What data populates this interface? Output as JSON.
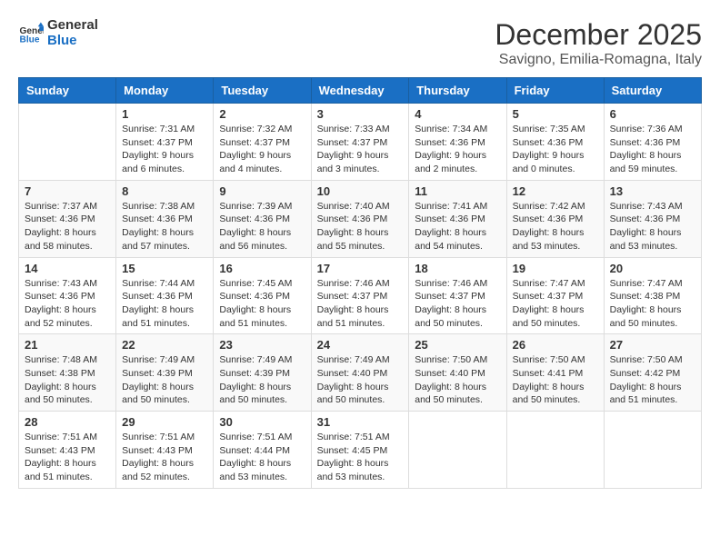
{
  "logo": {
    "text_general": "General",
    "text_blue": "Blue"
  },
  "header": {
    "month": "December 2025",
    "location": "Savigno, Emilia-Romagna, Italy"
  },
  "weekdays": [
    "Sunday",
    "Monday",
    "Tuesday",
    "Wednesday",
    "Thursday",
    "Friday",
    "Saturday"
  ],
  "weeks": [
    [
      {
        "day": "",
        "sunrise": "",
        "sunset": "",
        "daylight": ""
      },
      {
        "day": "1",
        "sunrise": "Sunrise: 7:31 AM",
        "sunset": "Sunset: 4:37 PM",
        "daylight": "Daylight: 9 hours and 6 minutes."
      },
      {
        "day": "2",
        "sunrise": "Sunrise: 7:32 AM",
        "sunset": "Sunset: 4:37 PM",
        "daylight": "Daylight: 9 hours and 4 minutes."
      },
      {
        "day": "3",
        "sunrise": "Sunrise: 7:33 AM",
        "sunset": "Sunset: 4:37 PM",
        "daylight": "Daylight: 9 hours and 3 minutes."
      },
      {
        "day": "4",
        "sunrise": "Sunrise: 7:34 AM",
        "sunset": "Sunset: 4:36 PM",
        "daylight": "Daylight: 9 hours and 2 minutes."
      },
      {
        "day": "5",
        "sunrise": "Sunrise: 7:35 AM",
        "sunset": "Sunset: 4:36 PM",
        "daylight": "Daylight: 9 hours and 0 minutes."
      },
      {
        "day": "6",
        "sunrise": "Sunrise: 7:36 AM",
        "sunset": "Sunset: 4:36 PM",
        "daylight": "Daylight: 8 hours and 59 minutes."
      }
    ],
    [
      {
        "day": "7",
        "sunrise": "Sunrise: 7:37 AM",
        "sunset": "Sunset: 4:36 PM",
        "daylight": "Daylight: 8 hours and 58 minutes."
      },
      {
        "day": "8",
        "sunrise": "Sunrise: 7:38 AM",
        "sunset": "Sunset: 4:36 PM",
        "daylight": "Daylight: 8 hours and 57 minutes."
      },
      {
        "day": "9",
        "sunrise": "Sunrise: 7:39 AM",
        "sunset": "Sunset: 4:36 PM",
        "daylight": "Daylight: 8 hours and 56 minutes."
      },
      {
        "day": "10",
        "sunrise": "Sunrise: 7:40 AM",
        "sunset": "Sunset: 4:36 PM",
        "daylight": "Daylight: 8 hours and 55 minutes."
      },
      {
        "day": "11",
        "sunrise": "Sunrise: 7:41 AM",
        "sunset": "Sunset: 4:36 PM",
        "daylight": "Daylight: 8 hours and 54 minutes."
      },
      {
        "day": "12",
        "sunrise": "Sunrise: 7:42 AM",
        "sunset": "Sunset: 4:36 PM",
        "daylight": "Daylight: 8 hours and 53 minutes."
      },
      {
        "day": "13",
        "sunrise": "Sunrise: 7:43 AM",
        "sunset": "Sunset: 4:36 PM",
        "daylight": "Daylight: 8 hours and 53 minutes."
      }
    ],
    [
      {
        "day": "14",
        "sunrise": "Sunrise: 7:43 AM",
        "sunset": "Sunset: 4:36 PM",
        "daylight": "Daylight: 8 hours and 52 minutes."
      },
      {
        "day": "15",
        "sunrise": "Sunrise: 7:44 AM",
        "sunset": "Sunset: 4:36 PM",
        "daylight": "Daylight: 8 hours and 51 minutes."
      },
      {
        "day": "16",
        "sunrise": "Sunrise: 7:45 AM",
        "sunset": "Sunset: 4:36 PM",
        "daylight": "Daylight: 8 hours and 51 minutes."
      },
      {
        "day": "17",
        "sunrise": "Sunrise: 7:46 AM",
        "sunset": "Sunset: 4:37 PM",
        "daylight": "Daylight: 8 hours and 51 minutes."
      },
      {
        "day": "18",
        "sunrise": "Sunrise: 7:46 AM",
        "sunset": "Sunset: 4:37 PM",
        "daylight": "Daylight: 8 hours and 50 minutes."
      },
      {
        "day": "19",
        "sunrise": "Sunrise: 7:47 AM",
        "sunset": "Sunset: 4:37 PM",
        "daylight": "Daylight: 8 hours and 50 minutes."
      },
      {
        "day": "20",
        "sunrise": "Sunrise: 7:47 AM",
        "sunset": "Sunset: 4:38 PM",
        "daylight": "Daylight: 8 hours and 50 minutes."
      }
    ],
    [
      {
        "day": "21",
        "sunrise": "Sunrise: 7:48 AM",
        "sunset": "Sunset: 4:38 PM",
        "daylight": "Daylight: 8 hours and 50 minutes."
      },
      {
        "day": "22",
        "sunrise": "Sunrise: 7:49 AM",
        "sunset": "Sunset: 4:39 PM",
        "daylight": "Daylight: 8 hours and 50 minutes."
      },
      {
        "day": "23",
        "sunrise": "Sunrise: 7:49 AM",
        "sunset": "Sunset: 4:39 PM",
        "daylight": "Daylight: 8 hours and 50 minutes."
      },
      {
        "day": "24",
        "sunrise": "Sunrise: 7:49 AM",
        "sunset": "Sunset: 4:40 PM",
        "daylight": "Daylight: 8 hours and 50 minutes."
      },
      {
        "day": "25",
        "sunrise": "Sunrise: 7:50 AM",
        "sunset": "Sunset: 4:40 PM",
        "daylight": "Daylight: 8 hours and 50 minutes."
      },
      {
        "day": "26",
        "sunrise": "Sunrise: 7:50 AM",
        "sunset": "Sunset: 4:41 PM",
        "daylight": "Daylight: 8 hours and 50 minutes."
      },
      {
        "day": "27",
        "sunrise": "Sunrise: 7:50 AM",
        "sunset": "Sunset: 4:42 PM",
        "daylight": "Daylight: 8 hours and 51 minutes."
      }
    ],
    [
      {
        "day": "28",
        "sunrise": "Sunrise: 7:51 AM",
        "sunset": "Sunset: 4:43 PM",
        "daylight": "Daylight: 8 hours and 51 minutes."
      },
      {
        "day": "29",
        "sunrise": "Sunrise: 7:51 AM",
        "sunset": "Sunset: 4:43 PM",
        "daylight": "Daylight: 8 hours and 52 minutes."
      },
      {
        "day": "30",
        "sunrise": "Sunrise: 7:51 AM",
        "sunset": "Sunset: 4:44 PM",
        "daylight": "Daylight: 8 hours and 53 minutes."
      },
      {
        "day": "31",
        "sunrise": "Sunrise: 7:51 AM",
        "sunset": "Sunset: 4:45 PM",
        "daylight": "Daylight: 8 hours and 53 minutes."
      },
      {
        "day": "",
        "sunrise": "",
        "sunset": "",
        "daylight": ""
      },
      {
        "day": "",
        "sunrise": "",
        "sunset": "",
        "daylight": ""
      },
      {
        "day": "",
        "sunrise": "",
        "sunset": "",
        "daylight": ""
      }
    ]
  ]
}
